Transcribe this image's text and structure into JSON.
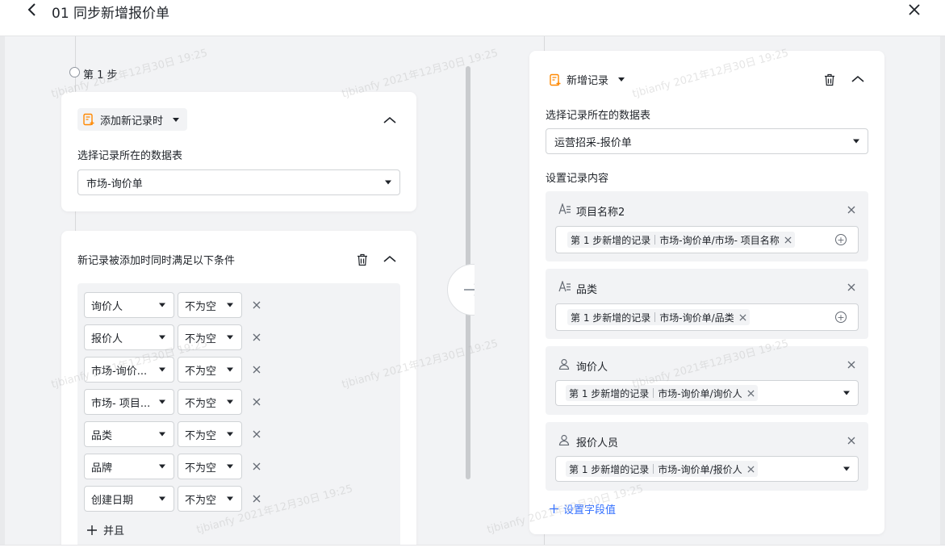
{
  "window": {
    "title": "01 同步新增报价单"
  },
  "left": {
    "step_label": "第 1 步",
    "trigger_name": "添加新记录时",
    "table_label": "选择记录所在的数据表",
    "table_value": "市场-询价单",
    "condition_title": "新记录被添加时同时满足以下条件",
    "conditions": [
      {
        "field": "询价人",
        "op": "不为空"
      },
      {
        "field": "报价人",
        "op": "不为空"
      },
      {
        "field": "市场-询价...",
        "op": "不为空"
      },
      {
        "field": "市场- 项目...",
        "op": "不为空"
      },
      {
        "field": "品类",
        "op": "不为空"
      },
      {
        "field": "品牌",
        "op": "不为空"
      },
      {
        "field": "创建日期",
        "op": "不为空"
      }
    ],
    "and_label": "并且"
  },
  "right": {
    "action_name": "新增记录",
    "table_label": "选择记录所在的数据表",
    "table_value": "运营招采-报价单",
    "content_label": "设置记录内容",
    "fields": [
      {
        "name": "项目名称2",
        "icon": "text-field-icon",
        "tag_step": "第 1 步新增的记录",
        "tag_path": "市场-询价单/市场- 项目名称",
        "mode": "plus"
      },
      {
        "name": "品类",
        "icon": "text-field-icon",
        "tag_step": "第 1 步新增的记录",
        "tag_path": "市场-询价单/品类",
        "mode": "plus"
      },
      {
        "name": "询价人",
        "icon": "person-icon",
        "tag_step": "第 1 步新增的记录",
        "tag_path": "市场-询价单/询价人",
        "mode": "select"
      },
      {
        "name": "报价人员",
        "icon": "person-icon",
        "tag_step": "第 1 步新增的记录",
        "tag_path": "市场-询价单/报价人",
        "mode": "select"
      }
    ],
    "add_field_label": "设置字段值"
  },
  "watermark": "tjbianfy 2021年12月30日 19:25",
  "colors": {
    "accent": "#3370ff",
    "trigger_icon": "#ff8800"
  }
}
